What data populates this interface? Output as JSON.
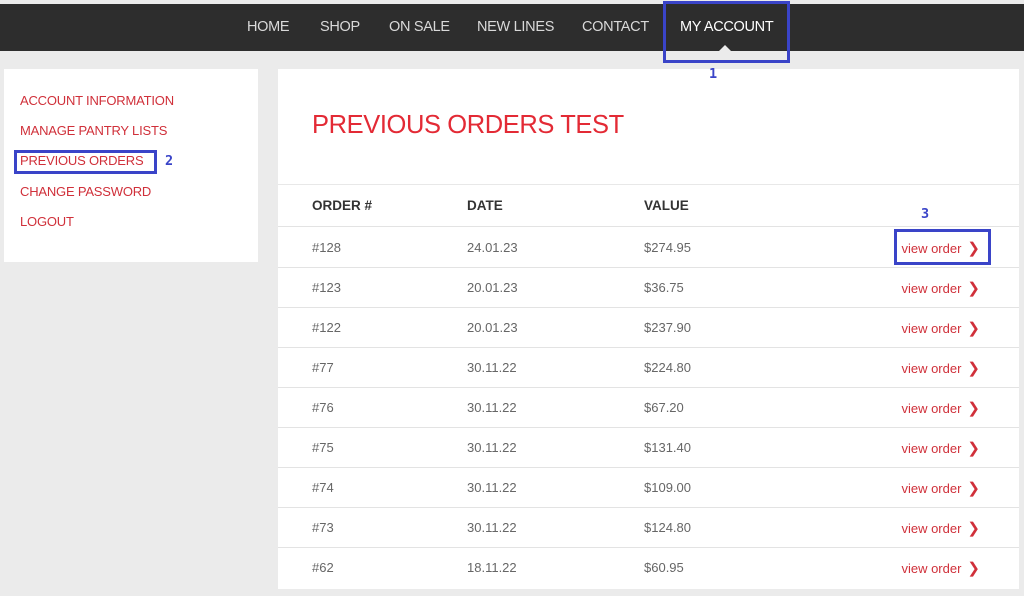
{
  "nav": {
    "items": [
      {
        "label": "HOME"
      },
      {
        "label": "SHOP"
      },
      {
        "label": "ON SALE"
      },
      {
        "label": "NEW LINES"
      },
      {
        "label": "CONTACT"
      },
      {
        "label": "MY ACCOUNT",
        "active": true
      }
    ]
  },
  "sidebar": {
    "items": [
      {
        "label": "ACCOUNT INFORMATION"
      },
      {
        "label": "MANAGE PANTRY LISTS"
      },
      {
        "label": "PREVIOUS ORDERS",
        "active": true
      },
      {
        "label": "CHANGE PASSWORD"
      },
      {
        "label": "LOGOUT"
      }
    ]
  },
  "main": {
    "title": "PREVIOUS ORDERS TEST",
    "columns": [
      "ORDER #",
      "DATE",
      "VALUE"
    ],
    "view_label": "view order",
    "orders": [
      {
        "order": "#128",
        "date": "24.01.23",
        "value": "$274.95"
      },
      {
        "order": "#123",
        "date": "20.01.23",
        "value": "$36.75"
      },
      {
        "order": "#122",
        "date": "20.01.23",
        "value": "$237.90"
      },
      {
        "order": "#77",
        "date": "30.11.22",
        "value": "$224.80"
      },
      {
        "order": "#76",
        "date": "30.11.22",
        "value": "$67.20"
      },
      {
        "order": "#75",
        "date": "30.11.22",
        "value": "$131.40"
      },
      {
        "order": "#74",
        "date": "30.11.22",
        "value": "$109.00"
      },
      {
        "order": "#73",
        "date": "30.11.22",
        "value": "$124.80"
      },
      {
        "order": "#62",
        "date": "18.11.22",
        "value": "$60.95"
      }
    ]
  },
  "annotations": {
    "labels": [
      "1",
      "2",
      "3"
    ]
  },
  "colors": {
    "nav_bg": "#2d2d2d",
    "accent_red": "#e32a35",
    "link_red": "#d0303a",
    "annotation_blue": "#3a44c8",
    "page_bg": "#ebebeb"
  },
  "icons": {
    "row_action": "chevron-right-icon"
  }
}
